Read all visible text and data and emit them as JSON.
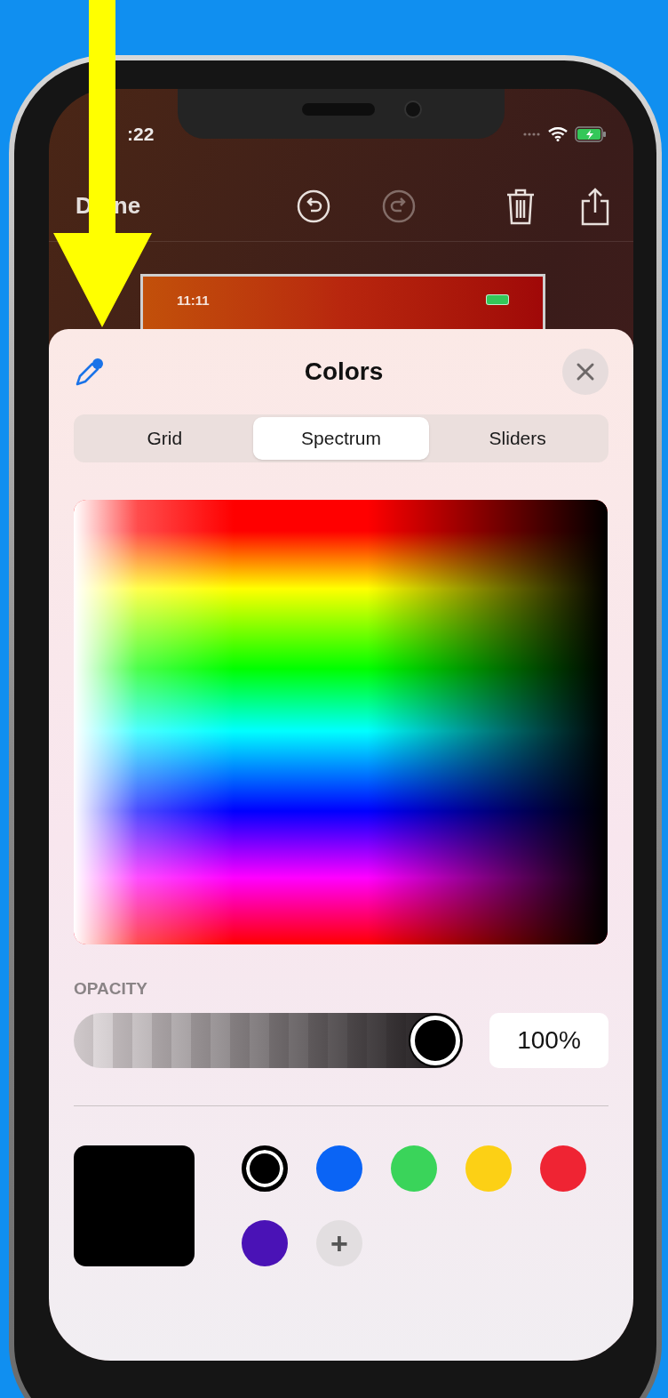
{
  "status_bar": {
    "time": ":22"
  },
  "toolbar": {
    "done_label_parts": [
      "D",
      "ne"
    ]
  },
  "preview": {
    "time": "11:11"
  },
  "sheet": {
    "title": "Colors",
    "tabs": [
      {
        "label": "Grid",
        "selected": false
      },
      {
        "label": "Spectrum",
        "selected": true
      },
      {
        "label": "Sliders",
        "selected": false
      }
    ],
    "opacity": {
      "label": "OPACITY",
      "level": 1,
      "reading": "100%"
    },
    "swatches": [
      {
        "kind": "color",
        "color": "#000000",
        "selected": true
      },
      {
        "kind": "color",
        "color": "#0a64f5",
        "selected": false
      },
      {
        "kind": "color",
        "color": "#3ad45a",
        "selected": false
      },
      {
        "kind": "color",
        "color": "#fcd015",
        "selected": false
      },
      {
        "kind": "color",
        "color": "#ef2433",
        "selected": false
      },
      {
        "kind": "color",
        "color": "#4a12b6",
        "selected": false
      },
      {
        "kind": "add",
        "label": "+"
      }
    ]
  }
}
